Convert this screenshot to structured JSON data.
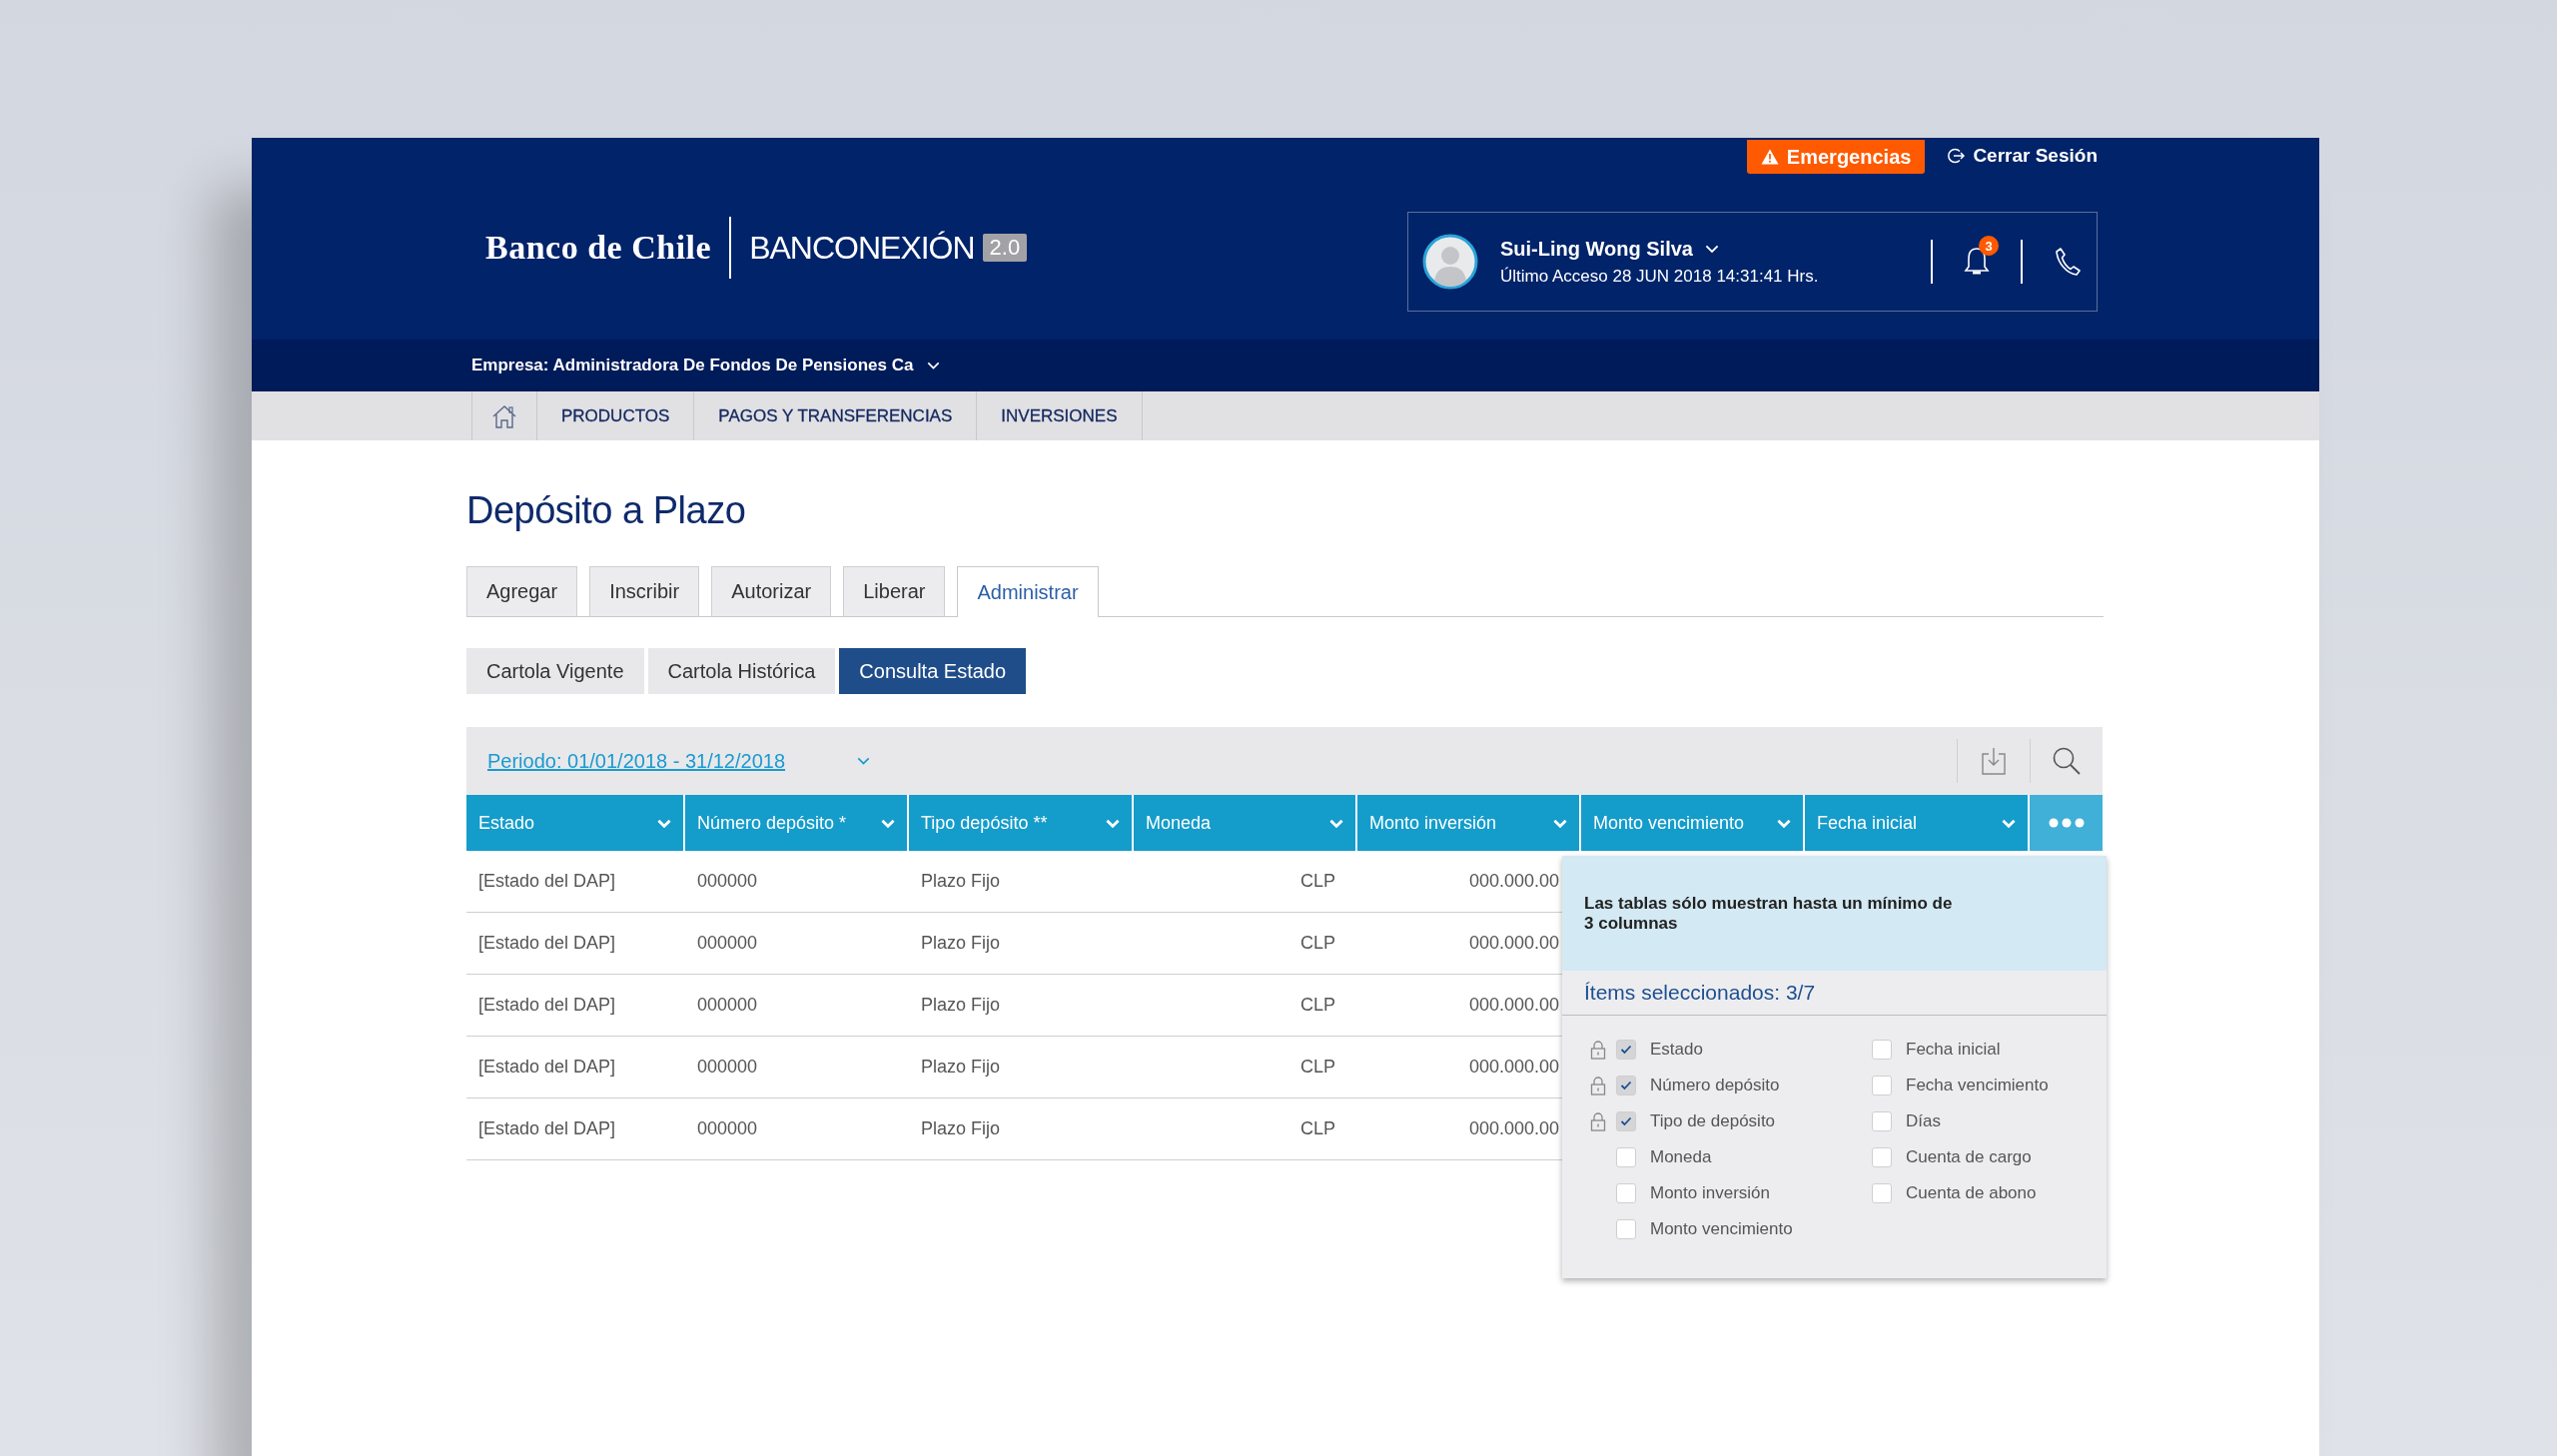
{
  "header": {
    "logo": "Banco de Chile",
    "product": "BANCONEXIÓN",
    "version": "2.0",
    "emergency_button": "Emergencias",
    "logout_link": "Cerrar Sesión",
    "user": {
      "name": "Sui-Ling Wong Silva",
      "last_access": "Último Acceso 28 JUN 2018 14:31:41 Hrs."
    },
    "notification_count": "3"
  },
  "company_selector": "Empresa: Administradora De Fondos De Pensiones Ca",
  "nav": [
    "PRODUCTOS",
    "PAGOS Y TRANSFERENCIAS",
    "INVERSIONES"
  ],
  "page_title": "Depósito a Plazo",
  "tabs": [
    {
      "label": "Agregar",
      "selected": false
    },
    {
      "label": "Inscribir",
      "selected": false
    },
    {
      "label": "Autorizar",
      "selected": false
    },
    {
      "label": "Liberar",
      "selected": false
    },
    {
      "label": "Administrar",
      "selected": true
    }
  ],
  "subtabs": [
    {
      "label": "Cartola Vigente",
      "selected": false
    },
    {
      "label": "Cartola Histórica",
      "selected": false
    },
    {
      "label": "Consulta Estado",
      "selected": true
    }
  ],
  "period_filter": "Periodo: 01/01/2018 - 31/12/2018",
  "table": {
    "columns": [
      "Estado",
      "Número depósito *",
      "Tipo depósito **",
      "Moneda",
      "Monto inversión",
      "Monto vencimiento",
      "Fecha inicial"
    ],
    "rows": [
      [
        "[Estado del DAP]",
        "000000",
        "Plazo Fijo",
        "CLP",
        "000.000.00"
      ],
      [
        "[Estado del DAP]",
        "000000",
        "Plazo Fijo",
        "CLP",
        "000.000.00"
      ],
      [
        "[Estado del DAP]",
        "000000",
        "Plazo Fijo",
        "CLP",
        "000.000.00"
      ],
      [
        "[Estado del DAP]",
        "000000",
        "Plazo Fijo",
        "CLP",
        "000.000.00"
      ],
      [
        "[Estado del DAP]",
        "000000",
        "Plazo Fijo",
        "CLP",
        "000.000.00"
      ]
    ]
  },
  "column_picker": {
    "message": "Las tablas sólo muestran hasta un mínimo de 3 columnas",
    "summary": "Ítems seleccionados: 3/7",
    "options": [
      {
        "label": "Estado",
        "checked": true,
        "locked": true
      },
      {
        "label": "Número depósito",
        "checked": true,
        "locked": true
      },
      {
        "label": "Tipo de depósito",
        "checked": true,
        "locked": true
      },
      {
        "label": "Moneda",
        "checked": false,
        "locked": false
      },
      {
        "label": "Monto inversión",
        "checked": false,
        "locked": false
      },
      {
        "label": "Monto vencimiento",
        "checked": false,
        "locked": false
      },
      {
        "label": "Fecha inicial",
        "checked": false,
        "locked": false
      },
      {
        "label": "Fecha vencimiento",
        "checked": false,
        "locked": false
      },
      {
        "label": "Días",
        "checked": false,
        "locked": false
      },
      {
        "label": "Cuenta de cargo",
        "checked": false,
        "locked": false
      },
      {
        "label": "Cuenta de abono",
        "checked": false,
        "locked": false
      }
    ]
  }
}
